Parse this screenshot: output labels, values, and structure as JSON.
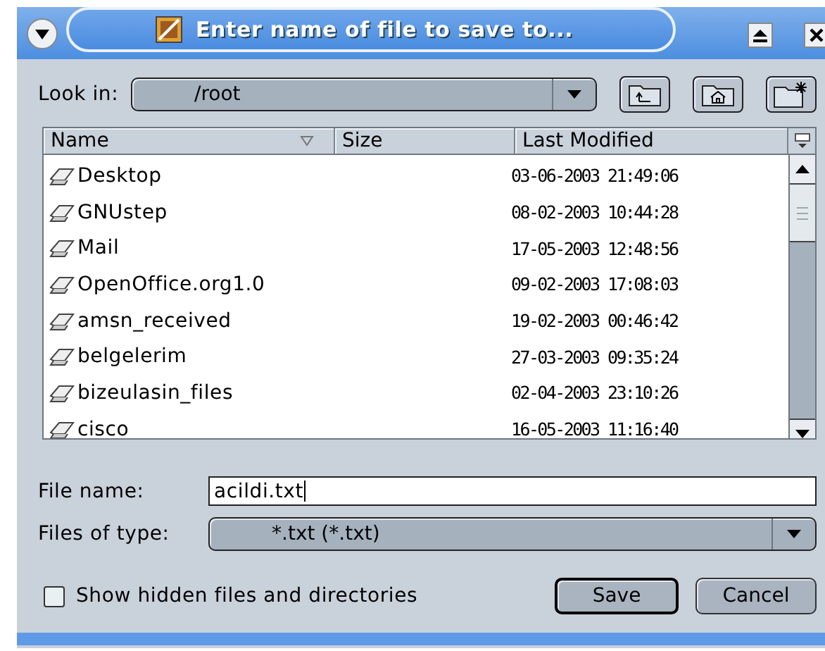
{
  "window": {
    "title": "Enter name of file to save to..."
  },
  "look_in": {
    "label": "Look in:",
    "value": "/root"
  },
  "file_list": {
    "columns": [
      {
        "label": "Name",
        "sorted": true
      },
      {
        "label": "Size",
        "sorted": false
      },
      {
        "label": "Last Modified",
        "sorted": false
      }
    ],
    "rows": [
      {
        "name": "Desktop",
        "modified": "03-06-2003 21:49:06"
      },
      {
        "name": "GNUstep",
        "modified": "08-02-2003 10:44:28"
      },
      {
        "name": "Mail",
        "modified": "17-05-2003 12:48:56"
      },
      {
        "name": "OpenOffice.org1.0",
        "modified": "09-02-2003 17:08:03"
      },
      {
        "name": "amsn_received",
        "modified": "19-02-2003 00:46:42"
      },
      {
        "name": "belgelerim",
        "modified": "27-03-2003 09:35:24"
      },
      {
        "name": "bizeulasin_files",
        "modified": "02-04-2003 23:10:26"
      },
      {
        "name": "cisco",
        "modified": "16-05-2003 11:16:40"
      }
    ]
  },
  "file_name": {
    "label": "File name:",
    "value": "acildi.txt"
  },
  "file_type": {
    "label": "Files of type:",
    "value": "*.txt (*.txt)"
  },
  "show_hidden": {
    "label": "Show hidden files and directories",
    "checked": false
  },
  "buttons": [
    {
      "label": "Save",
      "default": true
    },
    {
      "label": "Cancel",
      "default": false
    }
  ]
}
